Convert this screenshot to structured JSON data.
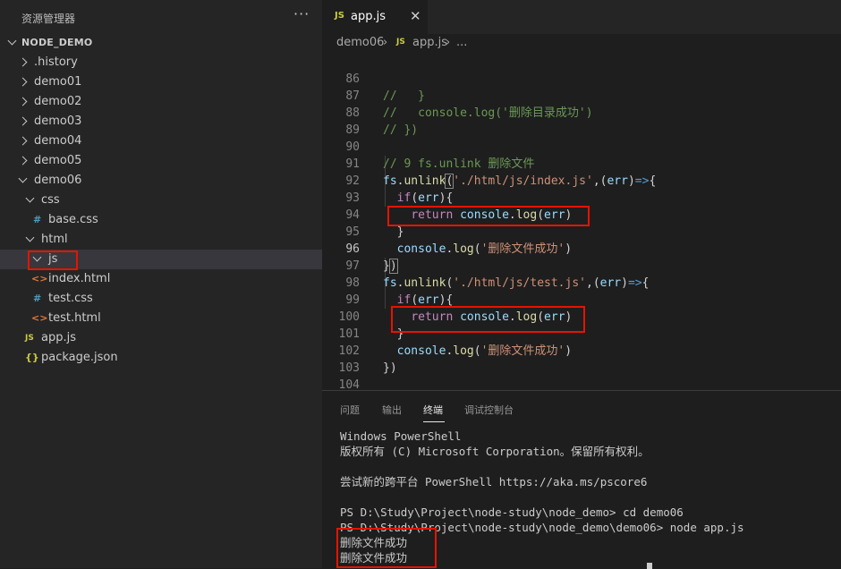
{
  "explorer": {
    "title": "资源管理器",
    "more": "···",
    "project": "NODE_DEMO",
    "items": [
      {
        "label": ".history",
        "icon": ""
      },
      {
        "label": "demo01",
        "icon": ""
      },
      {
        "label": "demo02",
        "icon": ""
      },
      {
        "label": "demo03",
        "icon": ""
      },
      {
        "label": "demo04",
        "icon": ""
      },
      {
        "label": "demo05",
        "icon": ""
      },
      {
        "label": "demo06",
        "icon": ""
      },
      {
        "label": "css",
        "icon": ""
      },
      {
        "label": "base.css",
        "icon": "#"
      },
      {
        "label": "html",
        "icon": ""
      },
      {
        "label": "js",
        "icon": ""
      },
      {
        "label": "index.html",
        "icon": "<>"
      },
      {
        "label": "test.css",
        "icon": "#"
      },
      {
        "label": "test.html",
        "icon": "<>"
      },
      {
        "label": "app.js",
        "icon": "JS"
      },
      {
        "label": "package.json",
        "icon": "{}"
      }
    ]
  },
  "tab": {
    "icon": "JS",
    "label": "app.js",
    "close": "✕"
  },
  "breadcrumb": {
    "folder": "demo06",
    "sep1": "›",
    "icon": "JS",
    "file": "app.js",
    "sep2": "›",
    "more": "..."
  },
  "code": {
    "line_numbers": [
      "86",
      "87",
      "88",
      "89",
      "90",
      "91",
      "92",
      "93",
      "94",
      "95",
      "96",
      "97",
      "98",
      "99",
      "100",
      "101",
      "102",
      "103",
      "104"
    ],
    "active_line": "96"
  },
  "panel": {
    "tabs": [
      "问题",
      "输出",
      "终端",
      "调试控制台"
    ],
    "active_tab": "终端",
    "terminal_lines": [
      "Windows PowerShell",
      "版权所有 (C) Microsoft Corporation。保留所有权利。",
      "",
      "尝试新的跨平台 PowerShell https://aka.ms/pscore6",
      "",
      "PS D:\\Study\\Project\\node-study\\node_demo> cd demo06",
      "PS D:\\Study\\Project\\node-study\\node_demo\\demo06> node app.js",
      "删除文件成功",
      "删除文件成功"
    ]
  },
  "colors": {
    "highlight_box": "#e51400",
    "sidebar_bg": "#252526",
    "editor_bg": "#1e1e1e",
    "js_icon": "#cbcb41",
    "css_icon": "#519aba",
    "html_icon": "#e37933",
    "json_icon": "#cbcb41"
  }
}
